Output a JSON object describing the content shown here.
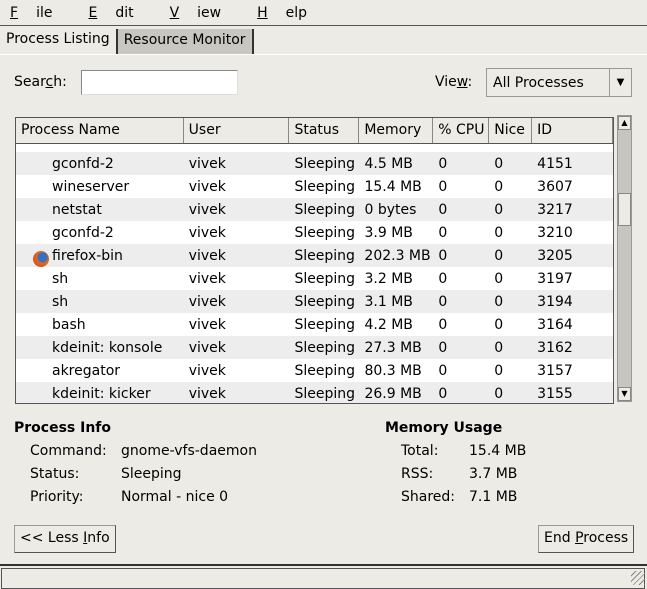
{
  "menu": [
    {
      "label": "File",
      "mnemonic": "F",
      "rest": "ile"
    },
    {
      "label": "Edit",
      "mnemonic": "E",
      "rest": "dit"
    },
    {
      "label": "View",
      "mnemonic": "V",
      "rest": "iew"
    },
    {
      "label": "Help",
      "mnemonic": "H",
      "rest": "elp"
    }
  ],
  "tabs": [
    {
      "label": "Process Listing",
      "active": true
    },
    {
      "label": "Resource Monitor",
      "active": false
    }
  ],
  "search": {
    "label_pre": "Sear",
    "label_mn": "c",
    "label_post": "h:",
    "value": ""
  },
  "view": {
    "label_pre": "Vie",
    "label_mn": "w",
    "label_post": ":",
    "selected": "All Processes"
  },
  "table": {
    "columns": [
      "Process Name",
      "User",
      "Status",
      "Memory",
      "% CPU",
      "Nice",
      "ID"
    ],
    "rows": [
      {
        "name": "gconfd-2",
        "user": "vivek",
        "status": "Sleeping",
        "memory": "4.5 MB",
        "cpu": "0",
        "nice": "0",
        "id": "4151"
      },
      {
        "name": "wineserver",
        "user": "vivek",
        "status": "Sleeping",
        "memory": "15.4 MB",
        "cpu": "0",
        "nice": "0",
        "id": "3607"
      },
      {
        "name": "netstat",
        "user": "vivek",
        "status": "Sleeping",
        "memory": "0 bytes",
        "cpu": "0",
        "nice": "0",
        "id": "3217"
      },
      {
        "name": "gconfd-2",
        "user": "vivek",
        "status": "Sleeping",
        "memory": "3.9 MB",
        "cpu": "0",
        "nice": "0",
        "id": "3210"
      },
      {
        "name": "firefox-bin",
        "user": "vivek",
        "status": "Sleeping",
        "memory": "202.3 MB",
        "cpu": "0",
        "nice": "0",
        "id": "3205",
        "icon": "firefox-icon"
      },
      {
        "name": "sh",
        "user": "vivek",
        "status": "Sleeping",
        "memory": "3.2 MB",
        "cpu": "0",
        "nice": "0",
        "id": "3197"
      },
      {
        "name": "sh",
        "user": "vivek",
        "status": "Sleeping",
        "memory": "3.1 MB",
        "cpu": "0",
        "nice": "0",
        "id": "3194"
      },
      {
        "name": "bash",
        "user": "vivek",
        "status": "Sleeping",
        "memory": "4.2 MB",
        "cpu": "0",
        "nice": "0",
        "id": "3164"
      },
      {
        "name": "kdeinit: konsole",
        "user": "vivek",
        "status": "Sleeping",
        "memory": "27.3 MB",
        "cpu": "0",
        "nice": "0",
        "id": "3162"
      },
      {
        "name": "akregator",
        "user": "vivek",
        "status": "Sleeping",
        "memory": "80.3 MB",
        "cpu": "0",
        "nice": "0",
        "id": "3157"
      },
      {
        "name": "kdeinit: kicker",
        "user": "vivek",
        "status": "Sleeping",
        "memory": "26.9 MB",
        "cpu": "0",
        "nice": "0",
        "id": "3155"
      }
    ]
  },
  "process_info": {
    "title": "Process Info",
    "command_label": "Command:",
    "command": "gnome-vfs-daemon",
    "status_label": "Status:",
    "status": "Sleeping",
    "priority_label": "Priority:",
    "priority": "Normal - nice 0"
  },
  "memory_usage": {
    "title": "Memory Usage",
    "total_label": "Total:",
    "total": "15.4 MB",
    "rss_label": "RSS:",
    "rss": "3.7 MB",
    "shared_label": "Shared:",
    "shared": "7.1 MB"
  },
  "buttons": {
    "less_info_pre": "<< Less ",
    "less_info_mn": "I",
    "less_info_post": "nfo",
    "end_process_pre": "End ",
    "end_process_mn": "P",
    "end_process_post": "rocess"
  }
}
